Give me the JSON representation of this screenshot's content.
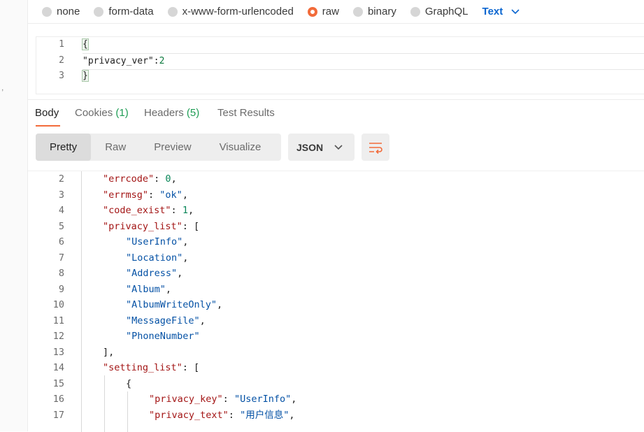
{
  "body_types": [
    {
      "label": "none",
      "selected": false
    },
    {
      "label": "form-data",
      "selected": false
    },
    {
      "label": "x-www-form-urlencoded",
      "selected": false
    },
    {
      "label": "raw",
      "selected": true
    },
    {
      "label": "binary",
      "selected": false
    },
    {
      "label": "GraphQL",
      "selected": false
    }
  ],
  "raw_type": "Text",
  "request_body": [
    {
      "ln": "1",
      "code": "{"
    },
    {
      "ln": "2",
      "key": "\"privacy_ver\"",
      "sep": ":",
      "num": "2"
    },
    {
      "ln": "3",
      "code": "}"
    }
  ],
  "response_tabs": {
    "body": "Body",
    "cookies": "Cookies",
    "cookies_count": "(1)",
    "headers": "Headers",
    "headers_count": "(5)",
    "test_results": "Test Results"
  },
  "view_modes": [
    "Pretty",
    "Raw",
    "Preview",
    "Visualize"
  ],
  "active_view": "Pretty",
  "format": "JSON",
  "colors": {
    "accent": "#f26b3a",
    "link": "#0b66d0",
    "count": "#1f9d55"
  },
  "response_lines": [
    {
      "ln": "2",
      "indent": 1,
      "parts": [
        [
          "k",
          "\"errcode\""
        ],
        [
          "p",
          ": "
        ],
        [
          "n",
          "0"
        ],
        [
          "p",
          ","
        ]
      ]
    },
    {
      "ln": "3",
      "indent": 1,
      "parts": [
        [
          "k",
          "\"errmsg\""
        ],
        [
          "p",
          ": "
        ],
        [
          "s",
          "\"ok\""
        ],
        [
          "p",
          ","
        ]
      ]
    },
    {
      "ln": "4",
      "indent": 1,
      "parts": [
        [
          "k",
          "\"code_exist\""
        ],
        [
          "p",
          ": "
        ],
        [
          "n",
          "1"
        ],
        [
          "p",
          ","
        ]
      ]
    },
    {
      "ln": "5",
      "indent": 1,
      "parts": [
        [
          "k",
          "\"privacy_list\""
        ],
        [
          "p",
          ": ["
        ]
      ]
    },
    {
      "ln": "6",
      "indent": 2,
      "parts": [
        [
          "s",
          "\"UserInfo\""
        ],
        [
          "p",
          ","
        ]
      ]
    },
    {
      "ln": "7",
      "indent": 2,
      "parts": [
        [
          "s",
          "\"Location\""
        ],
        [
          "p",
          ","
        ]
      ]
    },
    {
      "ln": "8",
      "indent": 2,
      "parts": [
        [
          "s",
          "\"Address\""
        ],
        [
          "p",
          ","
        ]
      ]
    },
    {
      "ln": "9",
      "indent": 2,
      "parts": [
        [
          "s",
          "\"Album\""
        ],
        [
          "p",
          ","
        ]
      ]
    },
    {
      "ln": "10",
      "indent": 2,
      "parts": [
        [
          "s",
          "\"AlbumWriteOnly\""
        ],
        [
          "p",
          ","
        ]
      ]
    },
    {
      "ln": "11",
      "indent": 2,
      "parts": [
        [
          "s",
          "\"MessageFile\""
        ],
        [
          "p",
          ","
        ]
      ]
    },
    {
      "ln": "12",
      "indent": 2,
      "parts": [
        [
          "s",
          "\"PhoneNumber\""
        ]
      ]
    },
    {
      "ln": "13",
      "indent": 1,
      "parts": [
        [
          "p",
          "],"
        ]
      ]
    },
    {
      "ln": "14",
      "indent": 1,
      "parts": [
        [
          "k",
          "\"setting_list\""
        ],
        [
          "p",
          ": ["
        ]
      ]
    },
    {
      "ln": "15",
      "indent": 2,
      "parts": [
        [
          "p",
          "{"
        ]
      ]
    },
    {
      "ln": "16",
      "indent": 3,
      "parts": [
        [
          "k",
          "\"privacy_key\""
        ],
        [
          "p",
          ": "
        ],
        [
          "s",
          "\"UserInfo\""
        ],
        [
          "p",
          ","
        ]
      ]
    },
    {
      "ln": "17",
      "indent": 3,
      "parts": [
        [
          "k",
          "\"privacy_text\""
        ],
        [
          "p",
          ": "
        ],
        [
          "s",
          "\"用户信息\""
        ],
        [
          "p",
          ","
        ]
      ]
    }
  ]
}
